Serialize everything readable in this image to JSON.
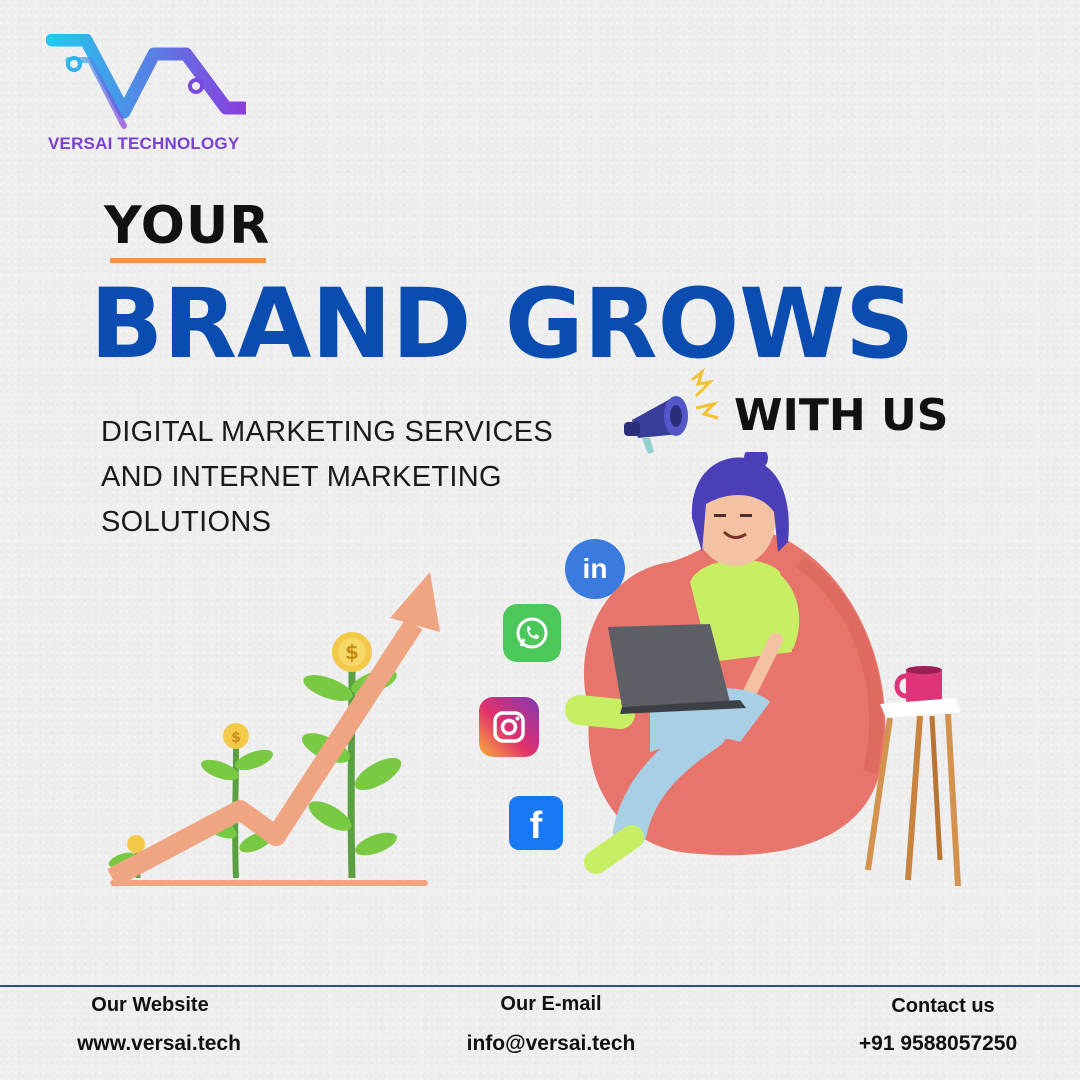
{
  "brand": {
    "logo_text": "VERSAI TECHNOLOGY",
    "logo_icon": "versai-wave-logo",
    "colors": {
      "logo_gradient_start": "#22c8ee",
      "logo_gradient_end": "#8a3ddc"
    }
  },
  "headline": {
    "line1": "YOUR",
    "line2": "BRAND GROWS",
    "line3": "WITH US",
    "accent_color": "#0a4cb0",
    "underline_color": "#f0924a"
  },
  "tagline": {
    "lines": [
      "DIGITAL MARKETING SERVICES",
      "AND INTERNET MARKETING",
      "SOLUTIONS"
    ]
  },
  "illustrations": {
    "megaphone": "megaphone-icon",
    "growth": "growth-chart-with-coin-plants",
    "person": "woman-on-beanbag-with-laptop",
    "table": "side-table-with-mug"
  },
  "social": [
    {
      "icon": "linkedin-icon",
      "label": "in",
      "color": "#3b7be0"
    },
    {
      "icon": "whatsapp-icon",
      "color": "#4cc85a"
    },
    {
      "icon": "instagram-icon",
      "color": "#d62976"
    },
    {
      "icon": "facebook-icon",
      "label": "f",
      "color": "#1877f2"
    }
  ],
  "footer": {
    "website": {
      "label": "Our Website",
      "value": "www.versai.tech"
    },
    "email": {
      "label": "Our E-mail",
      "value": "info@versai.tech"
    },
    "contact": {
      "label": "Contact us",
      "value": "+91 9588057250"
    },
    "rule_color": "#2a4f8f"
  }
}
